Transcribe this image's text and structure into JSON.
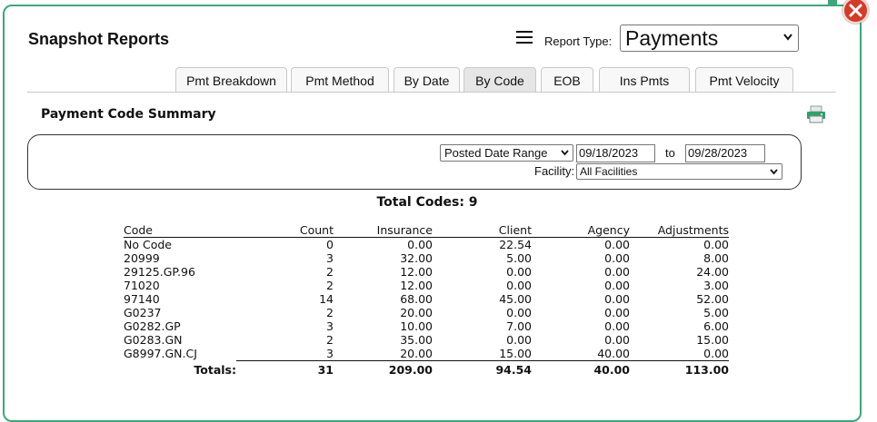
{
  "dialog": {
    "title": "Snapshot Reports",
    "report_type_label": "Report Type:",
    "report_type_value": "Payments"
  },
  "tabs": [
    {
      "label": "Pmt Breakdown",
      "active": false
    },
    {
      "label": "Pmt Method",
      "active": false
    },
    {
      "label": "By Date",
      "active": false
    },
    {
      "label": "By Code",
      "active": true
    },
    {
      "label": "EOB",
      "active": false
    },
    {
      "label": "Ins Pmts",
      "active": false
    },
    {
      "label": "Pmt Velocity",
      "active": false
    }
  ],
  "section": {
    "title": "Payment Code Summary"
  },
  "filters": {
    "date_range_type": "Posted Date Range",
    "date_from": "09/18/2023",
    "to_label": "to",
    "date_to": "09/28/2023",
    "facility_label": "Facility:",
    "facility_value": "All Facilities"
  },
  "summary": {
    "total_codes_label": "Total Codes: 9"
  },
  "table": {
    "headers": [
      "Code",
      "Count",
      "Insurance",
      "Client",
      "Agency",
      "Adjustments"
    ],
    "rows": [
      [
        "No Code",
        "0",
        "0.00",
        "22.54",
        "0.00",
        "0.00"
      ],
      [
        "20999",
        "3",
        "32.00",
        "5.00",
        "0.00",
        "8.00"
      ],
      [
        "29125.GP.96",
        "2",
        "12.00",
        "0.00",
        "0.00",
        "24.00"
      ],
      [
        "71020",
        "2",
        "12.00",
        "0.00",
        "0.00",
        "3.00"
      ],
      [
        "97140",
        "14",
        "68.00",
        "45.00",
        "0.00",
        "52.00"
      ],
      [
        "G0237",
        "2",
        "20.00",
        "0.00",
        "0.00",
        "5.00"
      ],
      [
        "G0282.GP",
        "3",
        "10.00",
        "7.00",
        "0.00",
        "6.00"
      ],
      [
        "G0283.GN",
        "2",
        "35.00",
        "0.00",
        "0.00",
        "15.00"
      ],
      [
        "G8997.GN.CJ",
        "3",
        "20.00",
        "15.00",
        "40.00",
        "0.00"
      ]
    ],
    "totals_label": "Totals:",
    "totals": [
      "31",
      "209.00",
      "94.54",
      "40.00",
      "113.00"
    ]
  },
  "colors": {
    "dialog_border": "#3aa87a",
    "close_button": "#d43b2a"
  }
}
